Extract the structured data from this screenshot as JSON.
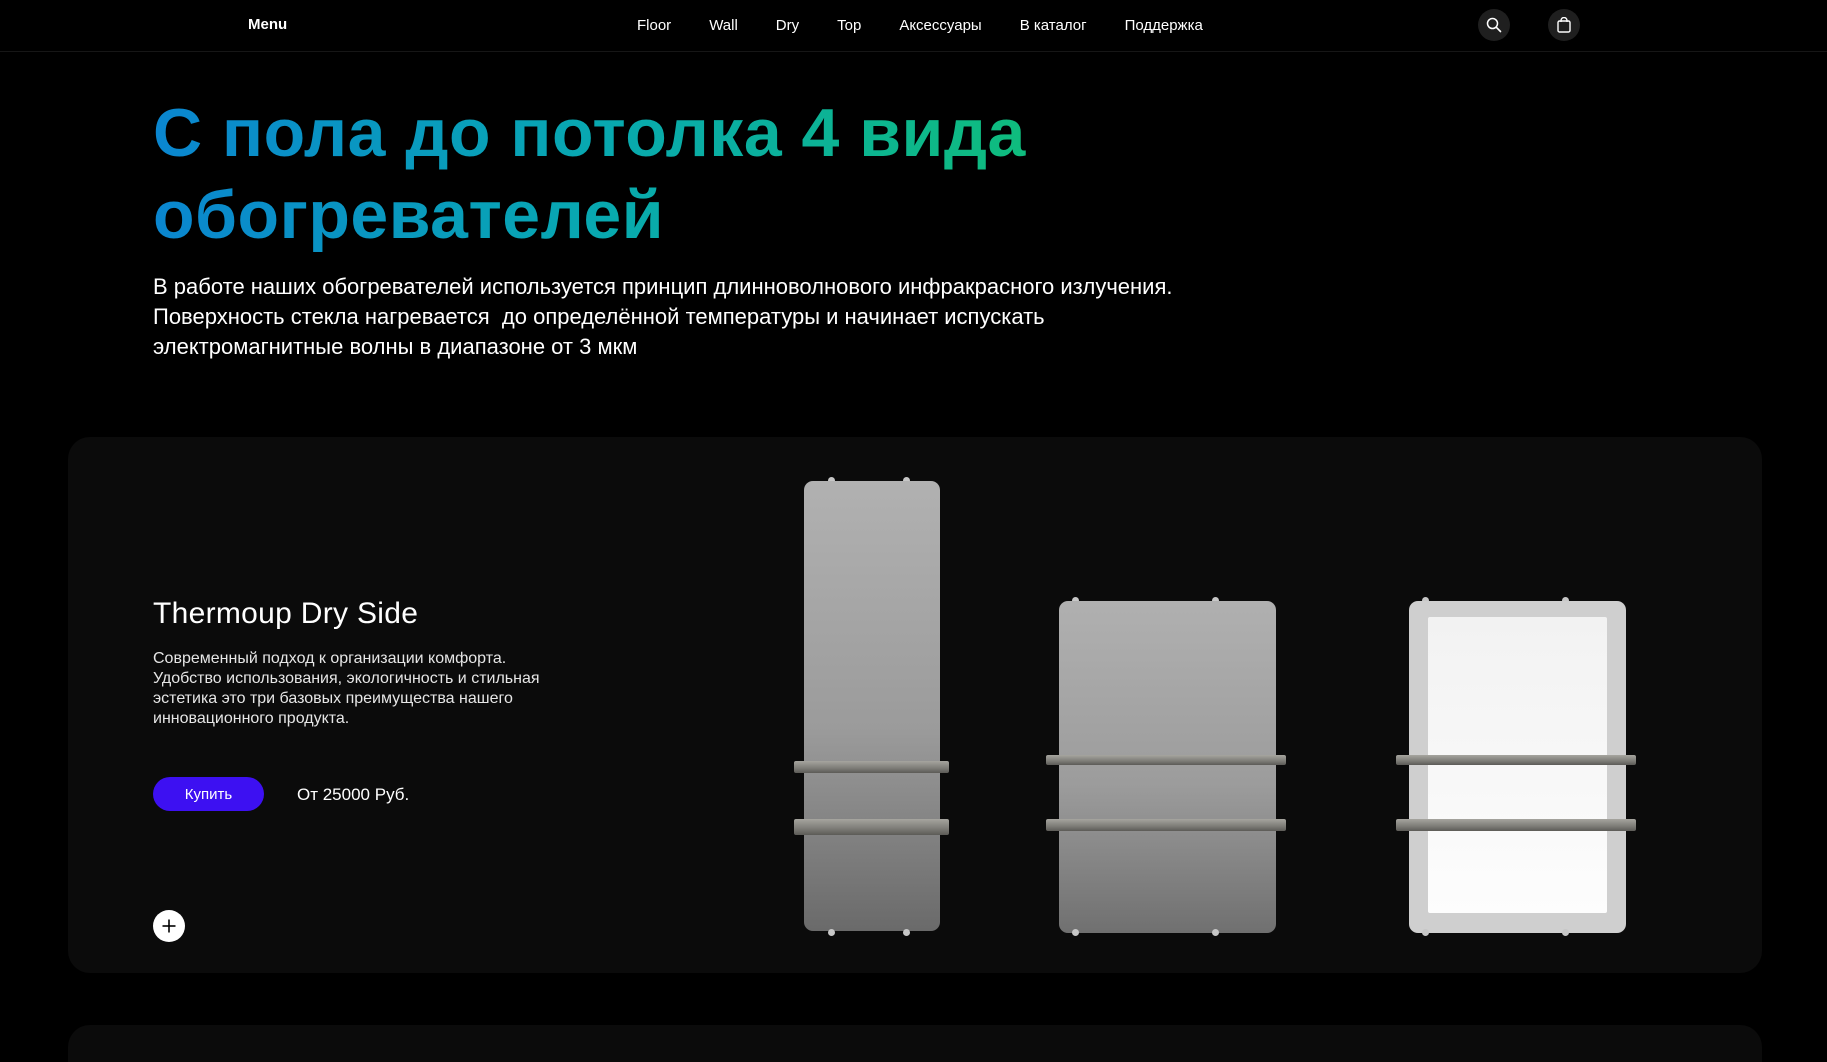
{
  "nav": {
    "menu_label": "Menu",
    "links": [
      "Floor",
      "Wall",
      "Dry",
      "Top",
      "Аксессуары",
      "В каталог",
      "Поддержка"
    ],
    "search_icon": "search-icon",
    "bag_icon": "shopping-bag-icon"
  },
  "hero": {
    "title_line1": "С пола до потолка 4 вида",
    "title_line2": "обогревателей",
    "desc_line1": "В работе наших обогревателей используется принцип длинноволнового инфракрасного излучения.",
    "desc_line2": "Поверхность стекла нагревается  до определённой температуры и начинает испускать",
    "desc_line3": "электромагнитные волны в диапазоне от 3 мкм"
  },
  "product": {
    "title": "Thermoup Dry Side",
    "desc_line1": "Современный подход к организации комфорта.",
    "desc_line2": "Удобство использования, экологичность и стильная",
    "desc_line3": "эстетика это три базовых преимущества нашего",
    "desc_line4": "инновационного продукта.",
    "buy_label": "Купить",
    "price": "От 25000 Руб.",
    "plus_icon": "plus-icon"
  },
  "colors": {
    "accent_button": "#3d10f2",
    "gradient_start": "#0a86d0",
    "gradient_end": "#11c26e"
  }
}
